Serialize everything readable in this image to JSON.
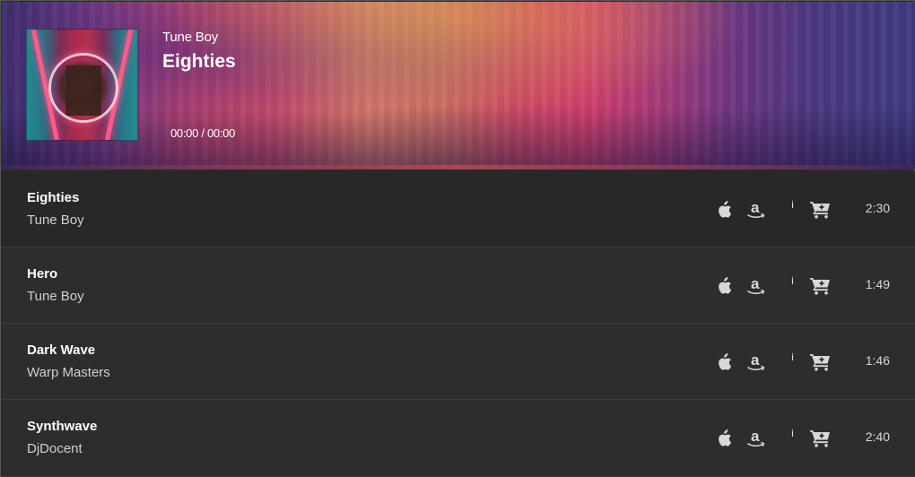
{
  "now_playing": {
    "artist": "Tune Boy",
    "title": "Eighties",
    "time": "00:00 / 00:00"
  },
  "playlist": [
    {
      "title": "Eighties",
      "artist": "Tune Boy",
      "duration": "2:30",
      "active": true
    },
    {
      "title": "Hero",
      "artist": "Tune Boy",
      "duration": "1:49",
      "active": false
    },
    {
      "title": "Dark Wave",
      "artist": "Warp Masters",
      "duration": "1:46",
      "active": false
    },
    {
      "title": "Synthwave",
      "artist": "DjDocent",
      "duration": "2:40",
      "active": false
    }
  ],
  "row_actions": {
    "apple_icon": "apple-icon",
    "amazon_icon": "amazon-icon",
    "info_label": "i",
    "cart_icon": "cart-add-icon"
  },
  "colors": {
    "row_bg": "#2d2d2d",
    "text_primary": "#ffffff",
    "text_secondary": "#cfcfcf",
    "icon": "#d8d8d8"
  }
}
